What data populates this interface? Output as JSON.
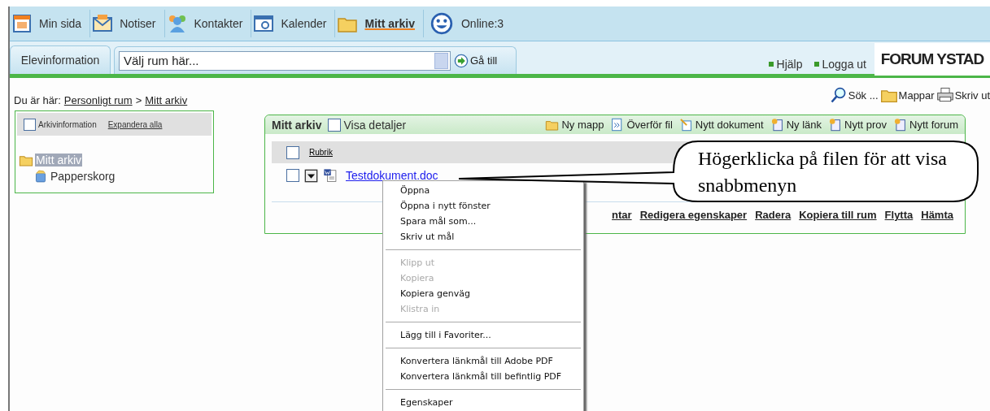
{
  "nav": {
    "items": [
      {
        "label": "Min sida",
        "selected": false
      },
      {
        "label": "Notiser",
        "selected": false
      },
      {
        "label": "Kontakter",
        "selected": false
      },
      {
        "label": "Kalender",
        "selected": false
      },
      {
        "label": "Mitt arkiv",
        "selected": true
      }
    ],
    "online": "Online:3"
  },
  "subbar": {
    "tab": "Elevinformation",
    "room_select": {
      "value": "Välj rum här..."
    },
    "go_button": "Gå till",
    "links": [
      "Hjälp",
      "Logga ut"
    ],
    "logo": "FORUM YSTAD"
  },
  "breadcrumb": {
    "label": "Du är här:",
    "items": [
      "Personligt rum",
      "Mitt arkiv"
    ],
    "separator": ">"
  },
  "tools": [
    "Sök ...",
    "Mappar",
    "Skriv ut"
  ],
  "tree_panel": {
    "checkbox": {
      "label": "Arkivinformation",
      "checked": false
    },
    "expand_link": "Expandera alla",
    "tree": [
      {
        "label": "Mitt arkiv",
        "selected": true,
        "children": [
          {
            "label": "Papperskorg",
            "selected": false
          }
        ]
      }
    ]
  },
  "archive_panel": {
    "title": "Mitt arkiv",
    "details_checkbox": {
      "label": "Visa detaljer",
      "checked": false
    },
    "toolbar": [
      "Ny mapp",
      "Överför fil",
      "Nytt dokument",
      "Ny länk",
      "Nytt prov",
      "Nytt forum"
    ],
    "table": {
      "header": "Rubrik",
      "header_checked": false,
      "rows": [
        {
          "name": "Testdokument.doc",
          "checked": false
        }
      ]
    },
    "actions": [
      "ntar",
      "Redigera egenskaper",
      "Radera",
      "Kopiera till rum",
      "Flytta",
      "Hämta"
    ]
  },
  "context_menu": {
    "groups": [
      [
        {
          "label": "Öppna",
          "disabled": false
        },
        {
          "label": "Öppna i nytt fönster",
          "disabled": false
        },
        {
          "label": "Spara mål som...",
          "disabled": false
        },
        {
          "label": "Skriv ut mål",
          "disabled": false
        }
      ],
      [
        {
          "label": "Klipp ut",
          "disabled": true
        },
        {
          "label": "Kopiera",
          "disabled": true
        },
        {
          "label": "Kopiera genväg",
          "disabled": false
        },
        {
          "label": "Klistra in",
          "disabled": true
        }
      ],
      [
        {
          "label": "Lägg till i Favoriter...",
          "disabled": false
        }
      ],
      [
        {
          "label": "Konvertera länkmål till Adobe PDF",
          "disabled": false
        },
        {
          "label": "Konvertera länkmål till befintlig PDF",
          "disabled": false
        }
      ],
      [
        {
          "label": "Egenskaper",
          "disabled": false
        }
      ]
    ]
  },
  "callout": {
    "text": "Högerklicka på filen för att visa snabbmenyn"
  }
}
